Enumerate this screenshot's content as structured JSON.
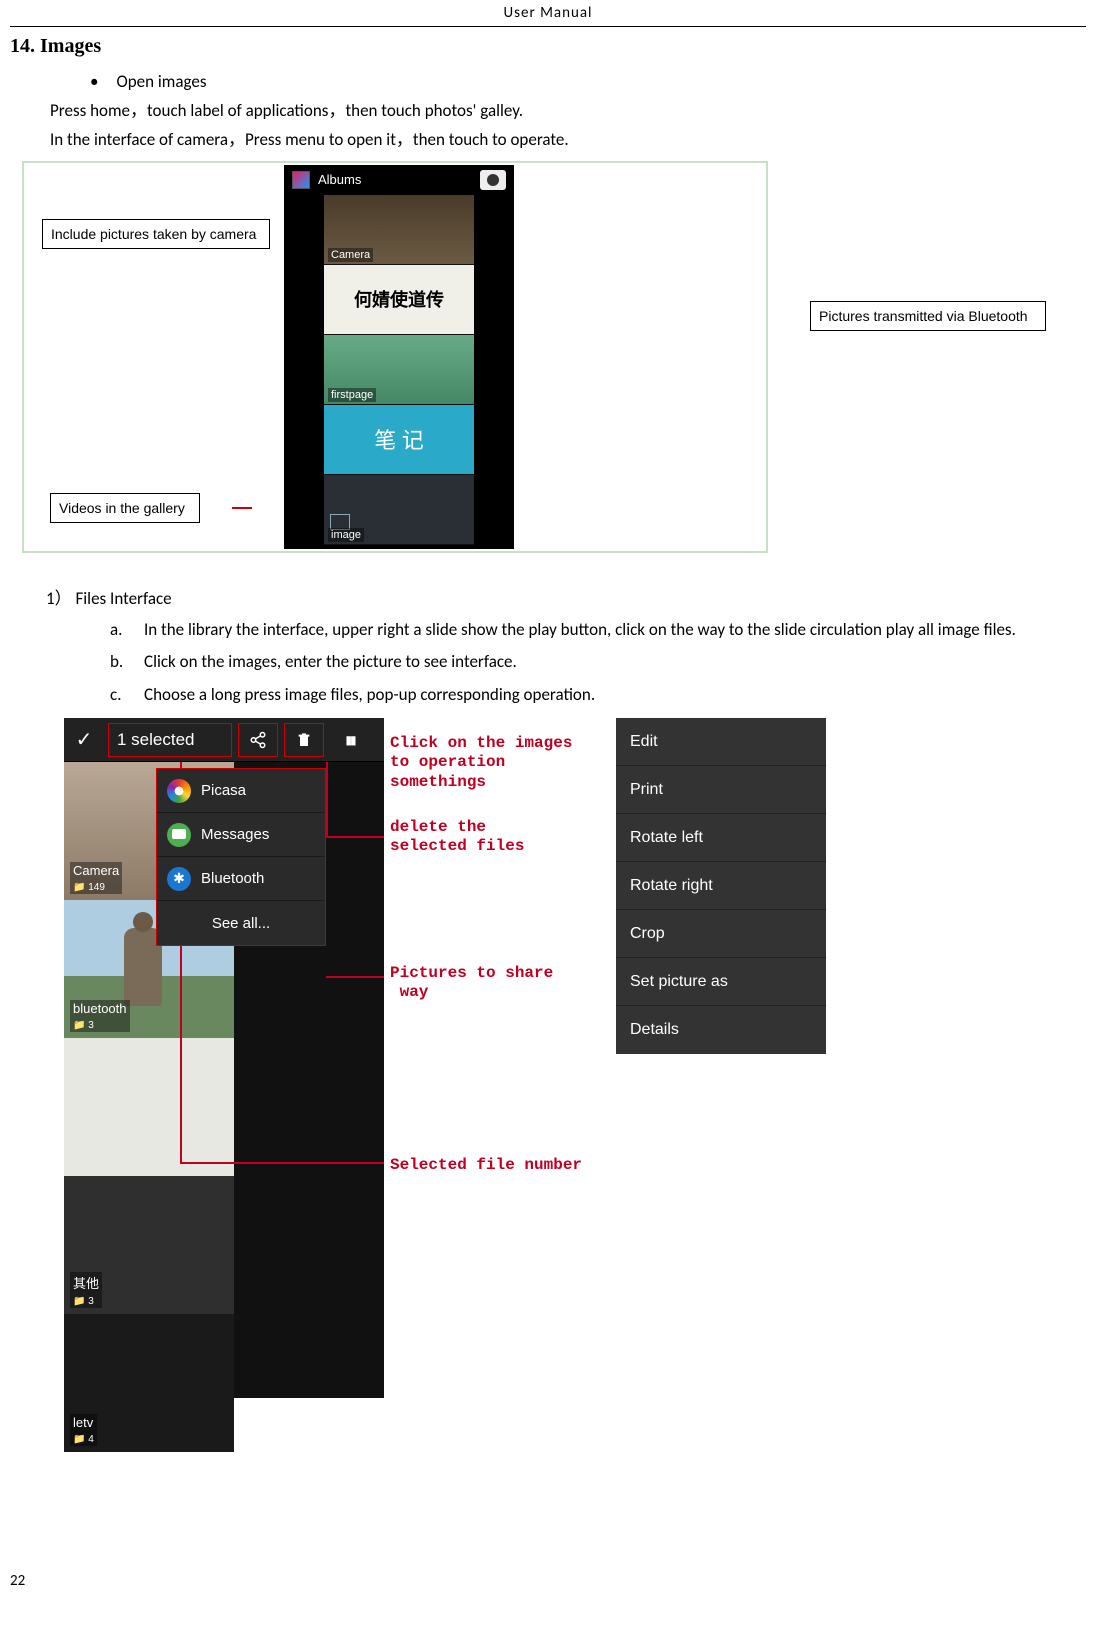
{
  "header": "User    Manual",
  "section_title": "14.  Images",
  "bullet_open": "Open images",
  "para1": "Press home，touch label of applications，then touch photos' galley.",
  "para2": "In the interface of camera，Press menu to open it，then touch to operate.",
  "fig1": {
    "callout_camera": "Include pictures taken by camera",
    "callout_bt": "Pictures transmitted via Bluetooth",
    "callout_video": "Videos in the gallery",
    "phone_title": "Albums",
    "alb_camera": "Camera",
    "alb_chinese": "何婧使道传",
    "alb_firstpage": "firstpage",
    "alb_note": "笔 记",
    "alb_image": "image"
  },
  "num_item": "1）",
  "num_title": "Files Interface",
  "sub": {
    "a": "In the library the interface, upper right a slide show the play button, click on the way to the slide circulation play all image files.",
    "b": "Click on the images, enter the picture to see interface.",
    "c": "Choose a long press image files, pop-up corresponding operation."
  },
  "fig2": {
    "selected": "1 selected",
    "share": {
      "picasa": "Picasa",
      "messages": "Messages",
      "bluetooth": "Bluetooth",
      "seeall": "See all..."
    },
    "tiles": {
      "camera": "Camera",
      "camera_cnt": "149",
      "bt": "bluetooth",
      "bt_cnt": "3",
      "other": "其他",
      "other_cnt": "3",
      "letv": "letv",
      "letv_cnt": "4"
    },
    "annots": {
      "op": "Click on the images\nto operation\nsomethings",
      "del": "delete the\nselected files",
      "shareway": "Pictures to share\n way",
      "selnum": "Selected file number"
    },
    "menu": {
      "edit": "Edit",
      "print": "Print",
      "rl": "Rotate left",
      "rr": "Rotate right",
      "crop": "Crop",
      "setas": "Set picture as",
      "details": "Details"
    }
  },
  "marks": {
    "a": "a.",
    "b": "b.",
    "c": "c."
  },
  "page_num": "22",
  "glyphs": {
    "check": "✓",
    "share": "<",
    "trash": "🗑",
    "bt": "B",
    "dots": "⋮"
  }
}
